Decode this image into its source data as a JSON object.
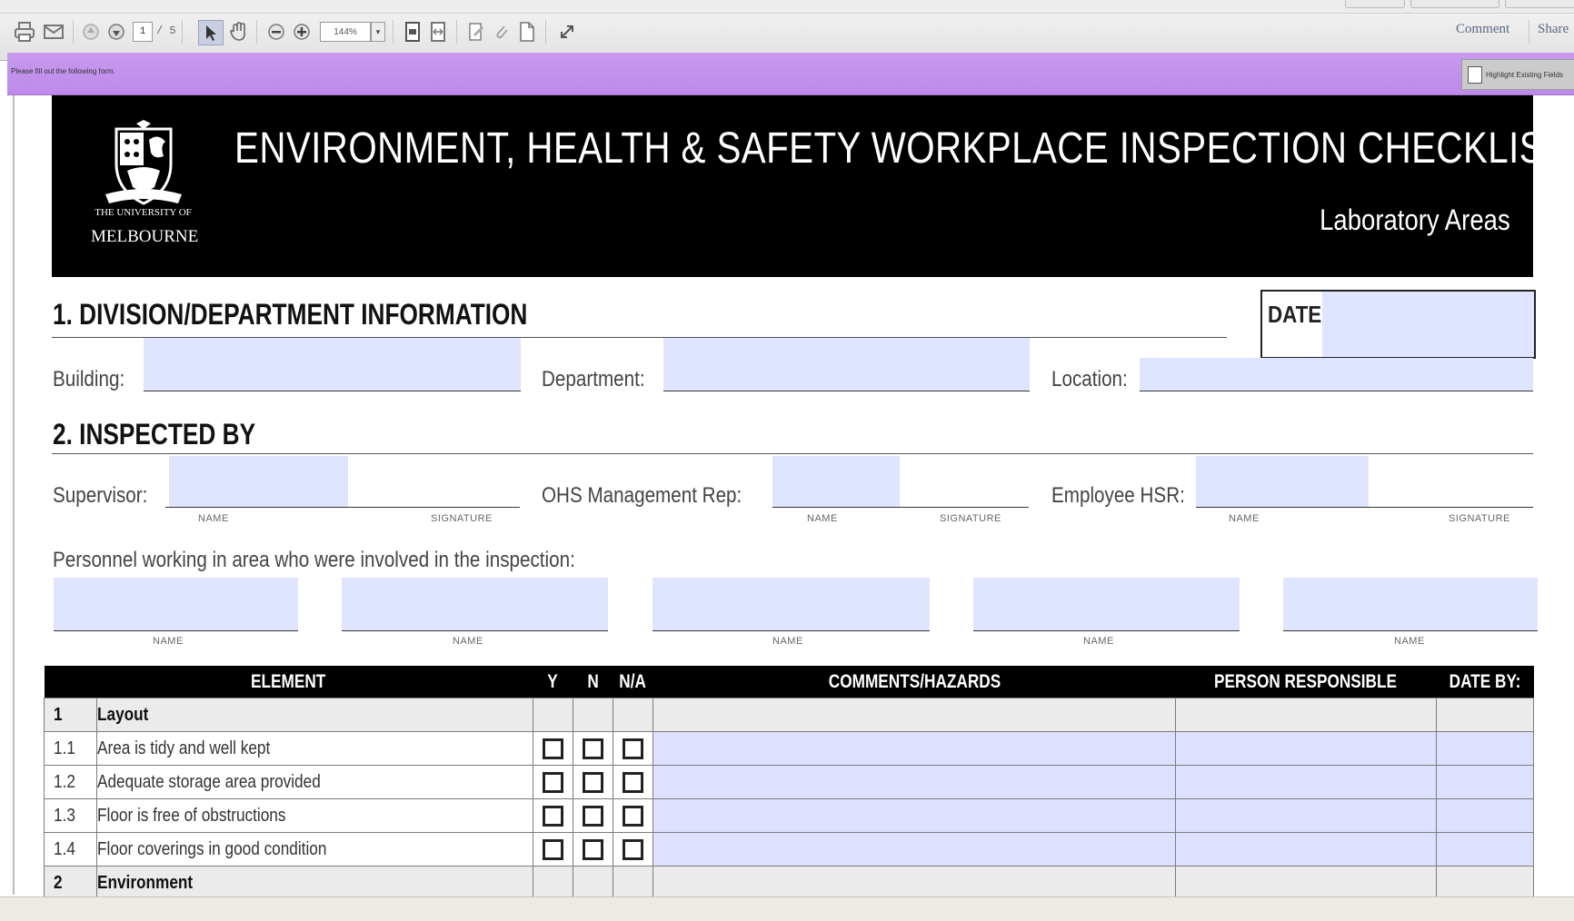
{
  "toolbar": {
    "page_current": "1",
    "page_total": "/ 5",
    "zoom": "144%",
    "comment_label": "Comment",
    "share_label": "Share"
  },
  "formbar": {
    "message": "Please fill out the following form.",
    "highlight_label": "Highlight Existing Fields"
  },
  "header": {
    "university_line1": "THE UNIVERSITY OF",
    "university_line2": "MELBOURNE",
    "title": "ENVIRONMENT, HEALTH & SAFETY WORKPLACE INSPECTION CHECKLIST",
    "subtitle": "Laboratory Areas"
  },
  "section1": {
    "heading": "1.  DIVISION/DEPARTMENT INFORMATION",
    "date_label": "DATE",
    "building_label": "Building:",
    "department_label": "Department:",
    "location_label": "Location:"
  },
  "section2": {
    "heading": "2.  INSPECTED BY",
    "supervisor_label": "Supervisor:",
    "ohs_label": "OHS Management Rep:",
    "hsr_label": "Employee HSR:",
    "name_caption": "NAME",
    "signature_caption": "SIGNATURE",
    "personnel_label": "Personnel working in area who were involved in the inspection:"
  },
  "table": {
    "headers": [
      "ELEMENT",
      "Y",
      "N",
      "N/A",
      "COMMENTS/HAZARDS",
      "PERSON RESPONSIBLE",
      "DATE BY:"
    ],
    "rows": [
      {
        "num": "1",
        "text": "Layout",
        "category": true
      },
      {
        "num": "1.1",
        "text": "Area is tidy and well kept",
        "category": false
      },
      {
        "num": "1.2",
        "text": "Adequate storage area provided",
        "category": false
      },
      {
        "num": "1.3",
        "text": "Floor is free of obstructions",
        "category": false
      },
      {
        "num": "1.4",
        "text": "Floor coverings in good condition",
        "category": false
      },
      {
        "num": "2",
        "text": "Environment",
        "category": true
      }
    ]
  },
  "colors": {
    "field_fill": "#dfe4ff",
    "formbar": "#c294ec",
    "header_bg": "#000000"
  }
}
